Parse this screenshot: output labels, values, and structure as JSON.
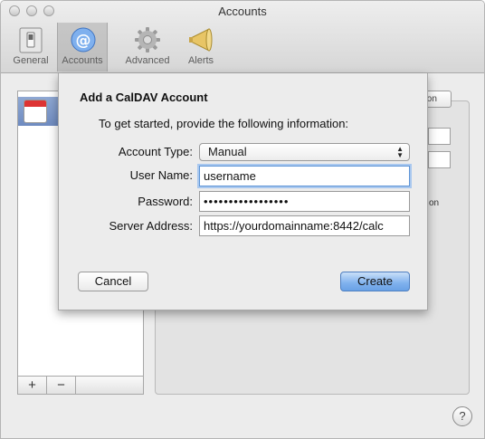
{
  "window": {
    "title": "Accounts"
  },
  "toolbar": {
    "items": [
      {
        "label": "General"
      },
      {
        "label": "Accounts"
      },
      {
        "label": "Advanced"
      },
      {
        "label": "Alerts"
      }
    ]
  },
  "background": {
    "list_add": "+",
    "list_remove": "−",
    "help": "?",
    "tab_partial": "Delegation",
    "partial_text": "on"
  },
  "sheet": {
    "title": "Add a CalDAV Account",
    "intro": "To get started, provide the following information:",
    "account_type_label": "Account Type:",
    "account_type_value": "Manual",
    "user_name_label": "User Name:",
    "user_name_value": "username",
    "password_label": "Password:",
    "password_value": "•••••••••••••••••",
    "server_label": "Server Address:",
    "server_value": "https://yourdomainname:8442/calc",
    "cancel": "Cancel",
    "create": "Create"
  },
  "colors": {
    "accent": "#6aa2e6",
    "selection": "#6f8bc0"
  }
}
